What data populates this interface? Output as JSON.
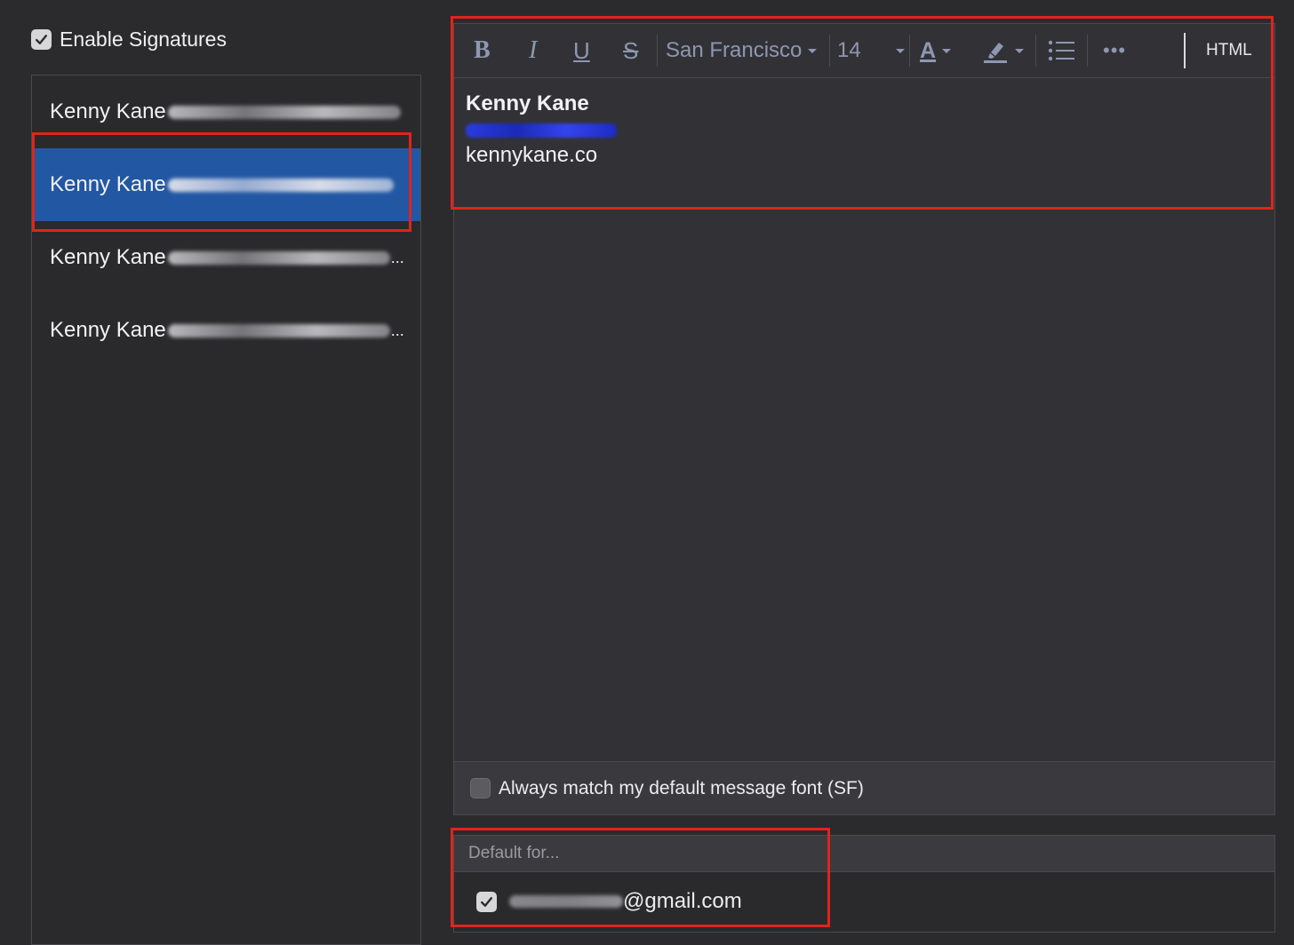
{
  "enable_signatures": {
    "label": "Enable Signatures",
    "checked": true
  },
  "signature_list": {
    "items": [
      {
        "name": "Kenny Kane",
        "selected": false,
        "ellipsis": ""
      },
      {
        "name": "Kenny Kane",
        "selected": true,
        "ellipsis": ""
      },
      {
        "name": "Kenny Kane",
        "selected": false,
        "ellipsis": "..."
      },
      {
        "name": "Kenny Kane",
        "selected": false,
        "ellipsis": "..."
      }
    ]
  },
  "toolbar": {
    "bold": "B",
    "italic": "I",
    "underline": "U",
    "strikethrough": "S",
    "font_family": "San Francisco",
    "font_size": "14",
    "text_color": "A",
    "highlight_icon": "highlighter-icon",
    "list_icon": "bullet-list-icon",
    "more": "•••",
    "html": "HTML"
  },
  "signature": {
    "name": "Kenny Kane",
    "website": "kennykane.co"
  },
  "match_font": {
    "label": "Always match my default message font (SF)",
    "checked": false
  },
  "default_for": {
    "header": "Default for...",
    "account_domain": "@gmail.com",
    "checked": true
  },
  "colors": {
    "selection": "#2257a3",
    "annotation": "#e0241b",
    "toolbar_icon": "#8e97b2"
  }
}
